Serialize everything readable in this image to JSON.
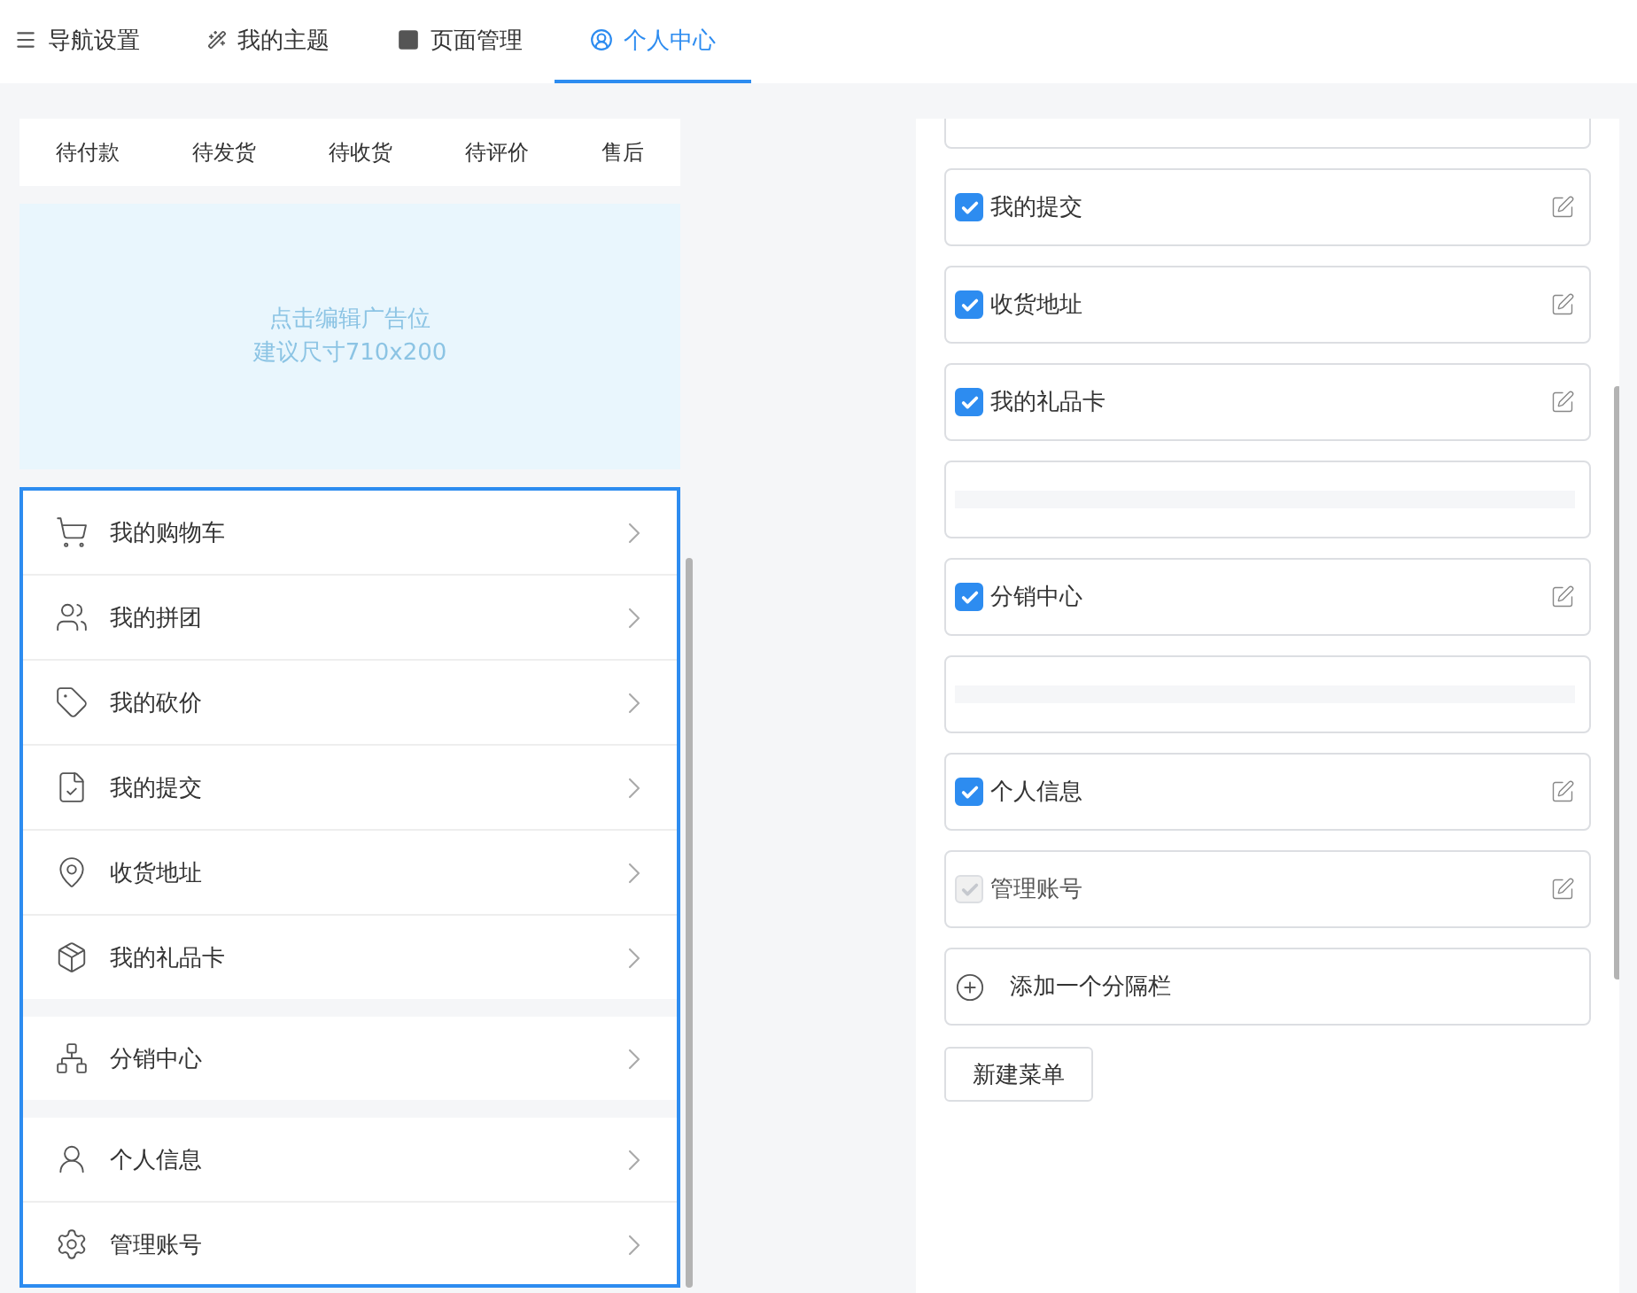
{
  "tabs": [
    {
      "label": "导航设置",
      "selected": false
    },
    {
      "label": "我的主题",
      "selected": false
    },
    {
      "label": "页面管理",
      "selected": false
    },
    {
      "label": "个人中心",
      "selected": true
    }
  ],
  "order_tabs": [
    "待付款",
    "待发货",
    "待收货",
    "待评价",
    "售后"
  ],
  "ad": {
    "title": "点击编辑广告位",
    "hint": "建议尺寸710x200"
  },
  "menu_groups": [
    {
      "items": [
        "我的购物车",
        "我的拼团",
        "我的砍价",
        "我的提交",
        "收货地址",
        "我的礼品卡"
      ]
    },
    {
      "items": [
        "分销中心"
      ]
    },
    {
      "items": [
        "个人信息",
        "管理账号"
      ]
    }
  ],
  "settings": [
    {
      "kind": "menu"
    },
    {
      "kind": "menu",
      "label": "我的提交",
      "checked": true,
      "disabled": false
    },
    {
      "kind": "menu",
      "label": "收货地址",
      "checked": true,
      "disabled": false
    },
    {
      "kind": "menu",
      "label": "我的礼品卡",
      "checked": true,
      "disabled": false
    },
    {
      "kind": "divider"
    },
    {
      "kind": "menu",
      "label": "分销中心",
      "checked": true,
      "disabled": false
    },
    {
      "kind": "divider"
    },
    {
      "kind": "menu",
      "label": "个人信息",
      "checked": true,
      "disabled": false
    },
    {
      "kind": "menu",
      "label": "管理账号",
      "checked": true,
      "disabled": true
    },
    {
      "kind": "add",
      "label": "添加一个分隔栏"
    }
  ],
  "new_menu_button": "新建菜单"
}
